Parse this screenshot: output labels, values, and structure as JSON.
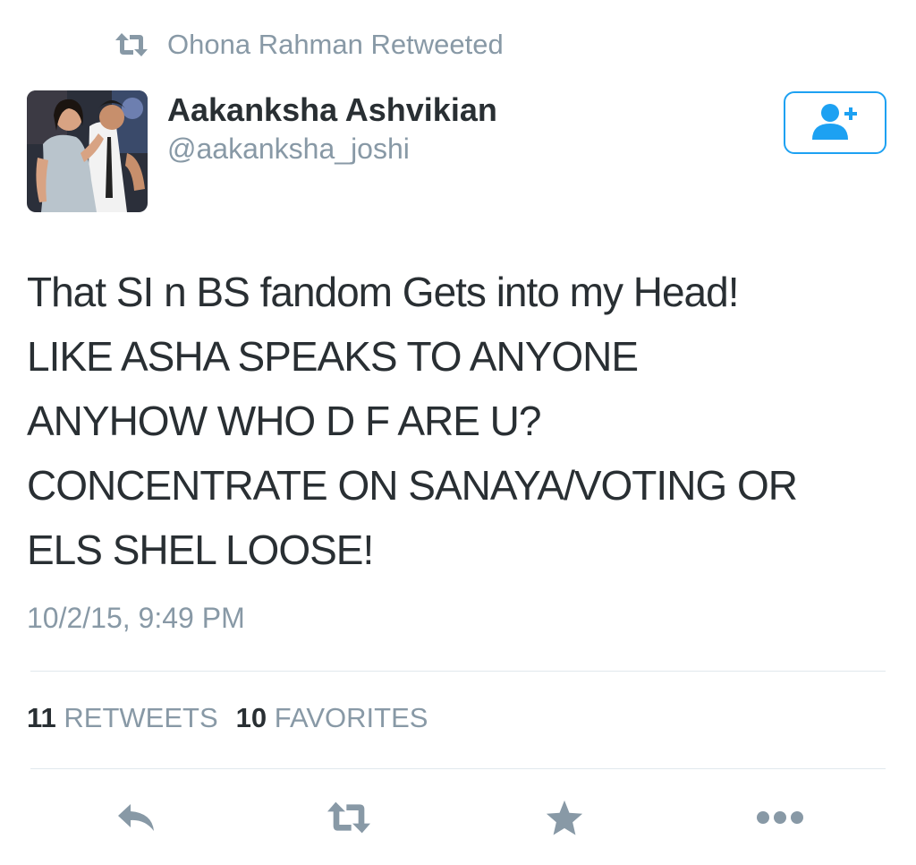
{
  "retweet_context": {
    "label": "Ohona Rahman Retweeted",
    "icon": "retweet-icon"
  },
  "author": {
    "name": "Aakanksha Ashvikian",
    "handle": "@aakanksha_joshi",
    "avatar": "profile-photo"
  },
  "follow_button": {
    "icon": "follow-user-plus-icon"
  },
  "tweet": {
    "lines": [
      "That SI n BS fandom Gets into my Head!",
      "LIKE ASHA SPEAKS TO ANYONE",
      "ANYHOW WHO D F ARE U?",
      "CONCENTRATE ON SANAYA/VOTING OR",
      "ELS SHEL LOOSE!"
    ],
    "timestamp": "10/2/15, 9:49 PM"
  },
  "stats": {
    "retweets_count": "11",
    "retweets_label": "RETWEETS",
    "favorites_count": "10",
    "favorites_label": "FAVORITES"
  },
  "actions": {
    "reply_icon": "reply-icon",
    "retweet_icon": "retweet-icon",
    "favorite_icon": "star-icon",
    "more_icon": "more-dots-icon"
  },
  "colors": {
    "text_dark": "#292f33",
    "text_gray": "#8899a6",
    "accent_blue": "#1da1f2",
    "divider": "#e1e8ed"
  }
}
